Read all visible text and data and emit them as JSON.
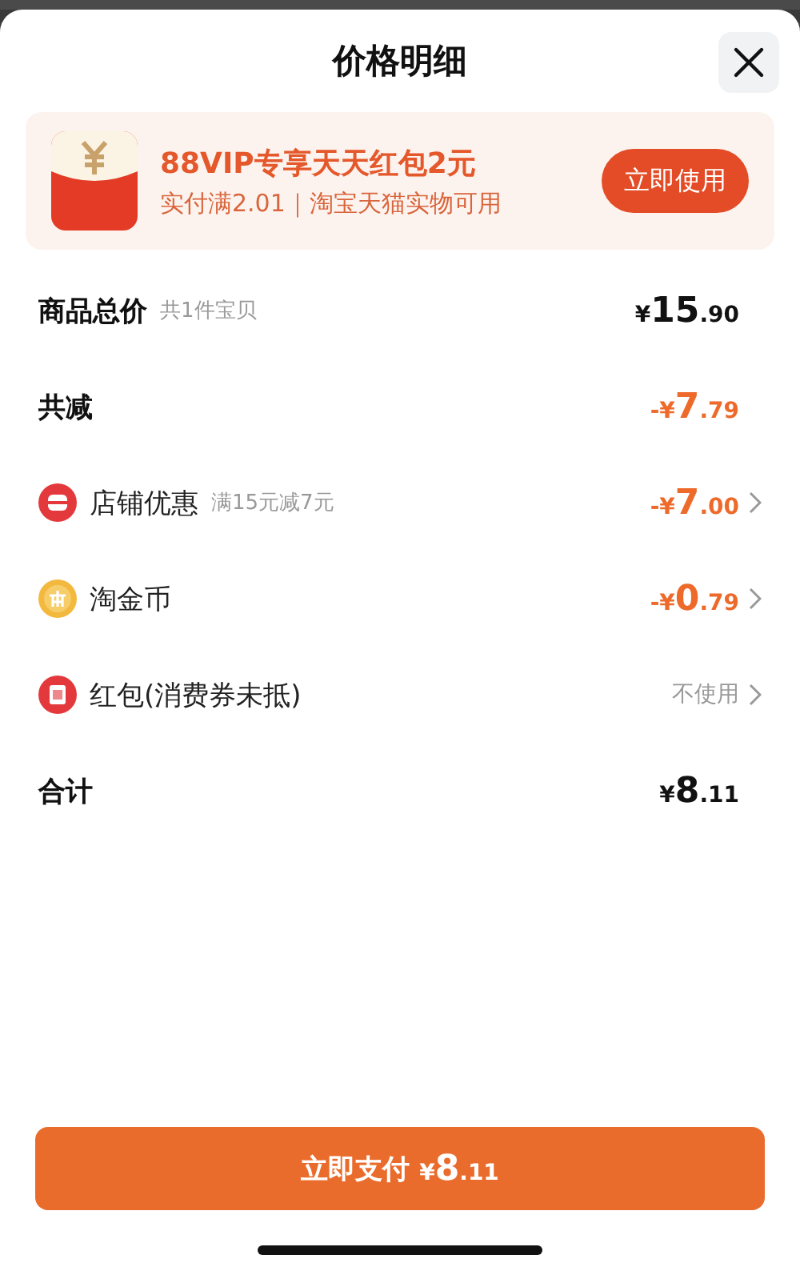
{
  "sheet": {
    "title": "价格明细"
  },
  "promo": {
    "title": "88VIP专享天天红包2元",
    "subtitle": "实付满2.01｜淘宝天猫实物可用",
    "button": "立即使用"
  },
  "rows": [
    {
      "kind": "header",
      "label": "商品总价",
      "note": "共1件宝贝",
      "price": {
        "sign": "¥",
        "whole": "15",
        "fraction": ".90"
      },
      "discount": false,
      "chevron": false
    },
    {
      "kind": "header",
      "label": "共减",
      "price": {
        "sign": "-¥",
        "whole": "7",
        "fraction": ".79"
      },
      "discount": true,
      "chevron": false
    },
    {
      "kind": "shop",
      "label": "店铺优惠",
      "note": "满15元减7元",
      "price": {
        "sign": "-¥",
        "whole": "7",
        "fraction": ".00"
      },
      "discount": true,
      "chevron": true
    },
    {
      "kind": "coin",
      "label": "淘金币",
      "price": {
        "sign": "-¥",
        "whole": "0",
        "fraction": ".79"
      },
      "discount": true,
      "chevron": true
    },
    {
      "kind": "packet",
      "label": "红包(消费券未抵)",
      "value": "不使用",
      "chevron": true
    },
    {
      "kind": "header",
      "label": "合计",
      "price": {
        "sign": "¥",
        "whole": "8",
        "fraction": ".11"
      },
      "discount": false,
      "chevron": false
    }
  ],
  "pay_button": {
    "label": "立即支付",
    "price": {
      "sign": "¥",
      "whole": "8",
      "fraction": ".11"
    }
  }
}
